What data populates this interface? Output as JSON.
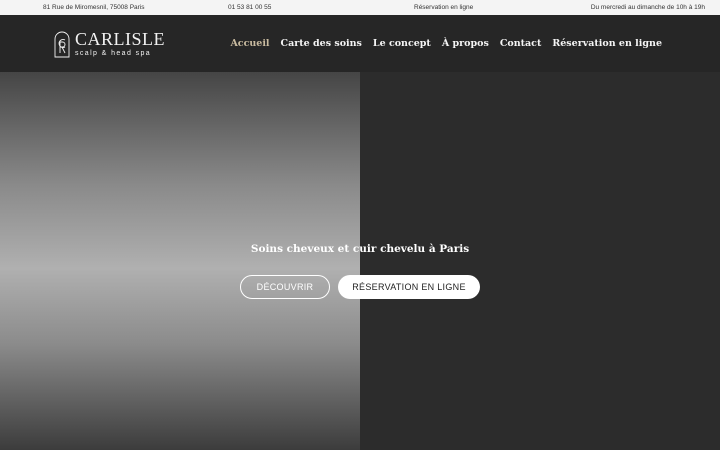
{
  "topbar": {
    "address": "81 Rue de Miromesnil, 75008 Paris",
    "phone": "01 53 81 00 55",
    "booking": "Réservation en ligne",
    "hours": "Du mercredi au dimanche de 10h à 19h"
  },
  "brand": {
    "name": "CARLISLE",
    "tagline": "scalp & head spa"
  },
  "nav": {
    "items": [
      {
        "label": "Accueil",
        "active": true
      },
      {
        "label": "Carte des soins"
      },
      {
        "label": "Le concept"
      },
      {
        "label": "À propos"
      },
      {
        "label": "Contact"
      },
      {
        "label": "Réservation en ligne"
      }
    ]
  },
  "hero": {
    "title": "Soins cheveux et cuir chevelu à Paris",
    "discover_label": "DÉCOUVRIR",
    "reserve_label": "RÉSERVATION EN LIGNE"
  },
  "colors": {
    "accent": "#c9bba0",
    "header_bg": "#262626",
    "topbar_bg": "#f4f4f4"
  }
}
